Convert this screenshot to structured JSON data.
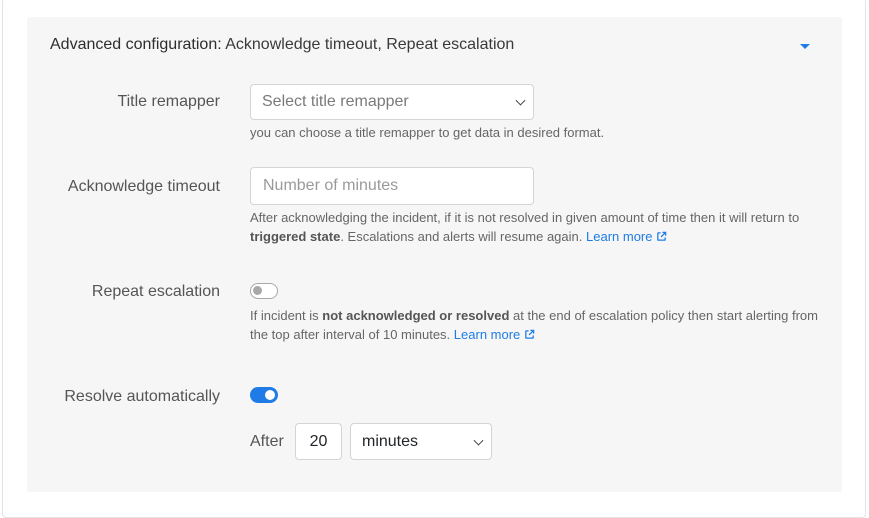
{
  "header": {
    "label": "Advanced configuration:",
    "value": "Acknowledge timeout, Repeat escalation"
  },
  "title_remapper": {
    "label": "Title remapper",
    "select_value": "Select title remapper",
    "help": "you can choose a title remapper to get data in desired format."
  },
  "ack_timeout": {
    "label": "Acknowledge timeout",
    "placeholder": "Number of minutes",
    "help_part1": "After acknowledging the incident, if it is not resolved in given amount of time then it will return to",
    "help_bold": "triggered state",
    "help_part2": ". Escalations and alerts will resume again.",
    "learn_more": "Learn more"
  },
  "repeat_escalation": {
    "label": "Repeat escalation",
    "enabled": false,
    "help_part1": "If incident is",
    "help_bold": "not acknowledged or resolved",
    "help_part2": "at the end of escalation policy then start alerting from the top after interval of 10 minutes.",
    "learn_more": "Learn more"
  },
  "resolve_automatically": {
    "label": "Resolve automatically",
    "enabled": true,
    "after_label": "After",
    "after_value": "20",
    "unit": "minutes"
  },
  "colors": {
    "accent": "#1f7ce6",
    "panel_bg": "#f6f6f6"
  }
}
